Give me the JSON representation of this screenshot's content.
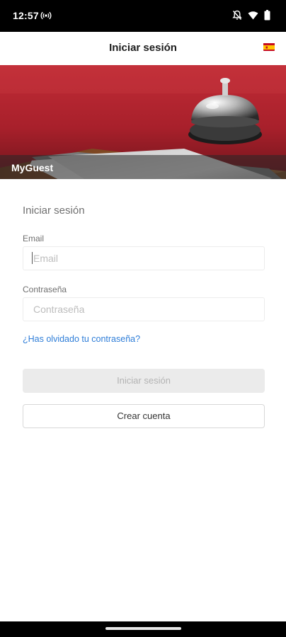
{
  "status_bar": {
    "time": "12:57",
    "icons": [
      "radio-signal-icon",
      "notifications-off-icon",
      "wifi-icon",
      "battery-icon"
    ]
  },
  "app_bar": {
    "title": "Iniciar sesión",
    "language_flag": "spain-flag-icon"
  },
  "hero": {
    "caption": "MyGuest"
  },
  "form": {
    "title": "Iniciar sesión",
    "email": {
      "label": "Email",
      "placeholder": "Email",
      "value": ""
    },
    "password": {
      "label": "Contraseña",
      "placeholder": "Contraseña",
      "value": ""
    },
    "forgot_password": "¿Has olvidado tu contraseña?",
    "login_button": "Iniciar sesión",
    "create_account_button": "Crear cuenta"
  },
  "colors": {
    "link": "#2f7ed8",
    "hero_red": "#b32631",
    "disabled_button": "#ebebeb"
  }
}
